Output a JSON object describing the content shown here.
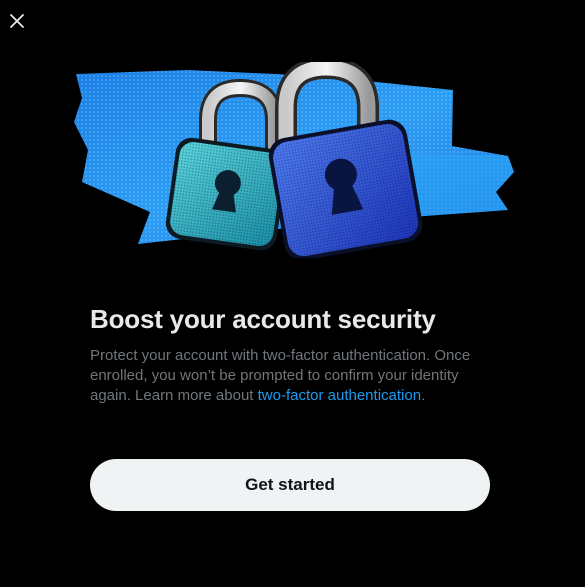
{
  "dialog": {
    "close_icon": "close-icon",
    "hero_image": "padlocks-illustration",
    "title": "Boost your account security",
    "description_before_link": "Protect your account with two-factor authentication. Once enrolled, you won’t be prompted to confirm your identity again. Learn more about ",
    "description_link": "two-factor authentication",
    "description_after_link": ".",
    "cta_label": "Get started"
  },
  "colors": {
    "background": "#000000",
    "title": "#e7e9ea",
    "secondary_text": "#71767b",
    "link": "#1d9bf0",
    "button_bg": "#eff3f4",
    "button_text": "#0f1419",
    "tape_blue": "#1d8cf0",
    "lock_teal": "#2fb6c4",
    "lock_blue": "#2a56d6"
  }
}
